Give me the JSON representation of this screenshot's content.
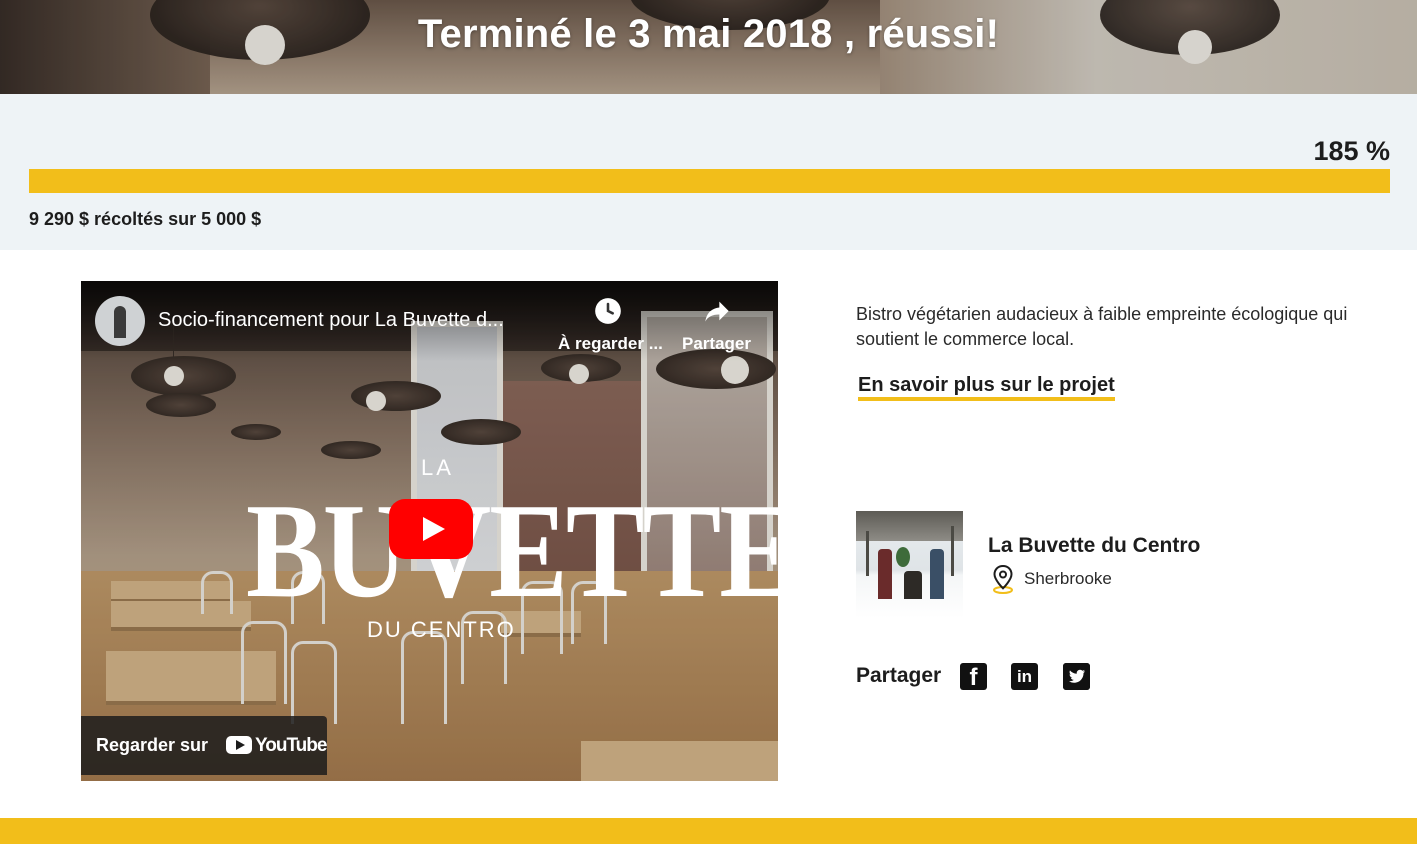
{
  "banner": {
    "title": "Terminé le 3 mai 2018 , réussi!"
  },
  "progress": {
    "percent_label": "185 %",
    "fill_fraction": 1.0,
    "raised_label": "9 290 $ récoltés sur 5 000 $",
    "bar_color": "#f2be1a"
  },
  "video": {
    "title": "Socio-financement pour La Buvette d...",
    "watch_later_label": "À regarder ...",
    "share_label": "Partager",
    "watch_on_label": "Regarder sur",
    "youtube_word": "YouTube",
    "logo_top": "LA",
    "logo_main": "BUVETTE",
    "logo_sub": "DU CENTRO"
  },
  "project": {
    "description": "Bistro végétarien audacieux à faible empreinte écologique qui soutient le commerce local.",
    "learn_more_label": "En savoir plus sur le projet",
    "owner_name": "La Buvette du Centro",
    "location": "Sherbrooke"
  },
  "share": {
    "label": "Partager",
    "networks": [
      "facebook",
      "linkedin",
      "twitter"
    ]
  },
  "footer": {
    "text": ""
  },
  "colors": {
    "accent": "#f2be1a",
    "section_bg": "#eef3f6"
  },
  "icons": {
    "watch_later": "clock-icon",
    "share": "share-arrow-icon",
    "location": "location-pin-icon"
  }
}
